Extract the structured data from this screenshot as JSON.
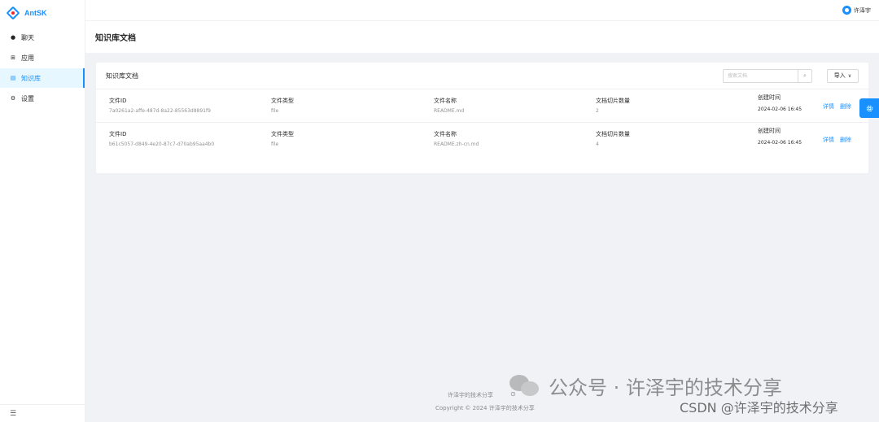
{
  "app": {
    "name": "AntSK"
  },
  "sidebar": {
    "items": [
      {
        "label": "聊天",
        "icon": "chat-icon",
        "glyph": "●"
      },
      {
        "label": "应用",
        "icon": "app-icon",
        "glyph": "⊞"
      },
      {
        "label": "知识库",
        "icon": "knowledge-base-icon",
        "glyph": "▤",
        "active": true
      },
      {
        "label": "设置",
        "icon": "settings-icon",
        "glyph": "⚙"
      }
    ],
    "collapse_glyph": "☰"
  },
  "header": {
    "user_name": "许泽宇"
  },
  "page": {
    "title": "知识库文档"
  },
  "card": {
    "title": "知识库文档",
    "search": {
      "placeholder": "搜索文档",
      "icon": "search-icon",
      "glyph": "⌕"
    },
    "import_label": "导入",
    "import_chevron": "∨"
  },
  "columns": {
    "id": "文件ID",
    "type": "文件类型",
    "name": "文件名称",
    "count": "文档切片数量",
    "time": "创建时间"
  },
  "actions": {
    "detail": "详情",
    "delete": "删除"
  },
  "rows": [
    {
      "id": "7a0261a2-affe-487d-8a22-85563d8891f9",
      "type": "file",
      "name": "README.md",
      "count": "2",
      "time": "2024-02-06 16:45"
    },
    {
      "id": "b61c5057-d849-4e20-87c7-d70ab95aa4b0",
      "type": "file",
      "name": "README.zh-cn.md",
      "count": "4",
      "time": "2024-02-06 16:45"
    }
  ],
  "footer": {
    "links": "许泽宇的技术分享",
    "github_glyph": "⊙",
    "copyright": "Copyright © 2024 许泽宇的技术分享"
  },
  "watermark": {
    "main": "公众号 · 许泽宇的技术分享",
    "csdn": "CSDN @许泽宇的技术分享"
  },
  "colors": {
    "primary": "#1890ff",
    "background": "#f0f2f5",
    "logo_accent": "#f5222d"
  }
}
